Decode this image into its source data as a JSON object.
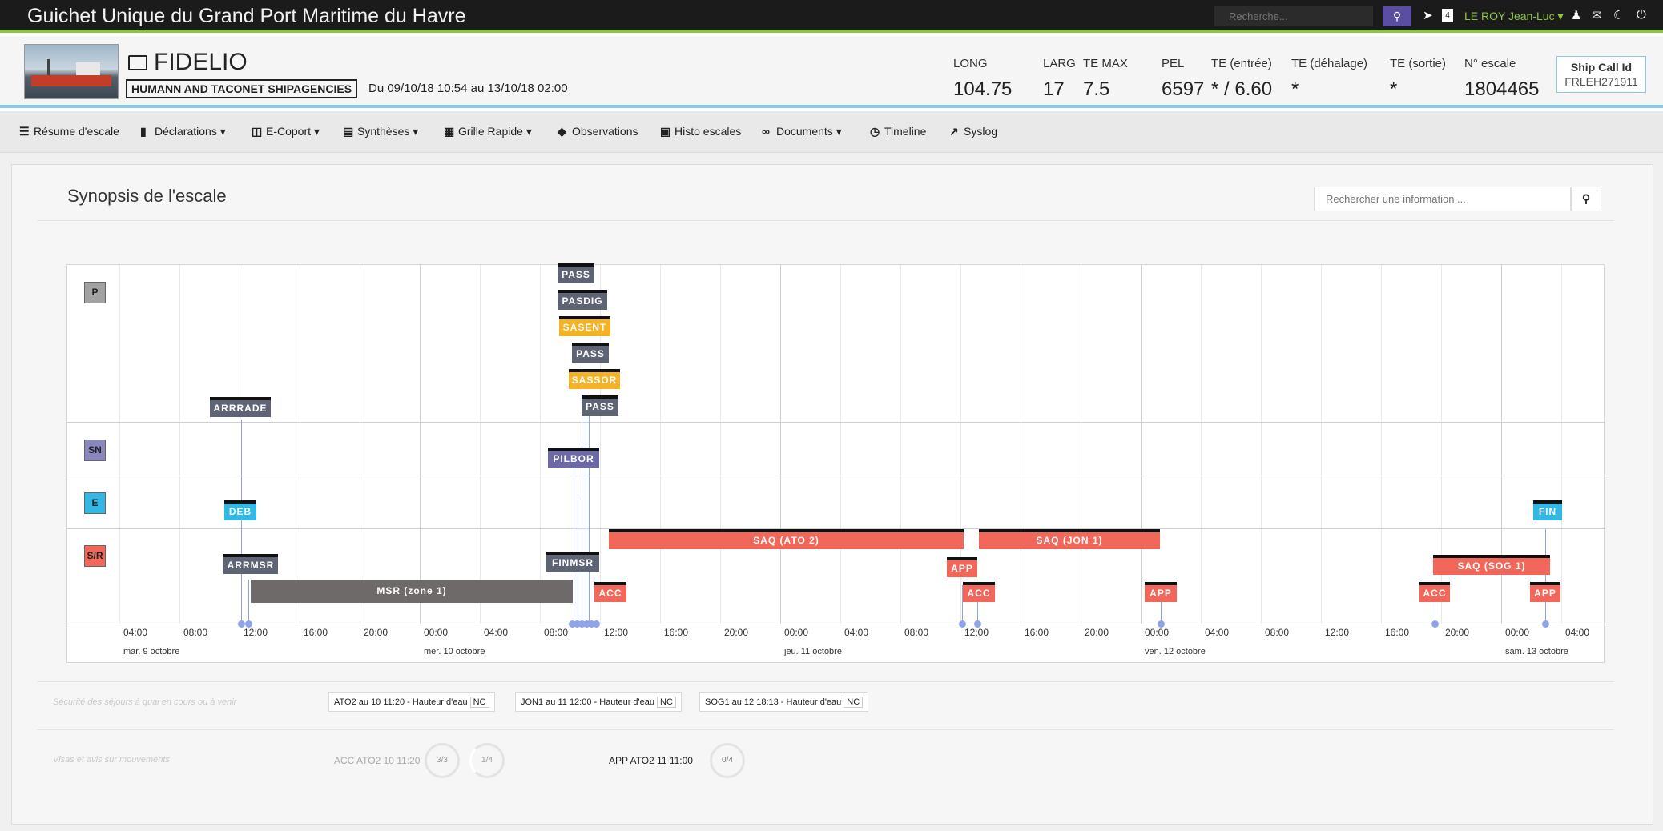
{
  "app": {
    "title": "Guichet Unique du Grand Port Maritime du Havre",
    "search_placeholder": "Recherche...",
    "notification_count": "4",
    "user": "LE ROY Jean-Luc ▾"
  },
  "ship": {
    "name": "FIDELIO",
    "agency": "HUMANN AND TACONET SHIPAGENCIES",
    "date_range": "Du 09/10/18 10:54 au 13/10/18 02:00",
    "metrics": [
      {
        "label": "LONG",
        "value": "104.75"
      },
      {
        "label": "LARG",
        "value": "17"
      },
      {
        "label": "TE MAX",
        "value": "7.5"
      },
      {
        "label": "PEL",
        "value": "6597"
      },
      {
        "label": "TE (entrée)",
        "value": "* / 6.60"
      },
      {
        "label": "TE (déhalage)",
        "value": "*"
      },
      {
        "label": "TE (sortie)",
        "value": "*"
      },
      {
        "label": "N° escale",
        "value": "1804465"
      }
    ],
    "ship_call_label": "Ship Call Id",
    "ship_call_id": "FRLEH271911"
  },
  "nav": {
    "items": [
      "Résume d'escale",
      "Déclarations ▾",
      "E-Coport ▾",
      "Synthèses ▾",
      "Grille Rapide ▾",
      "Observations",
      "Histo escales",
      "Documents ▾",
      "Timeline",
      "Syslog"
    ]
  },
  "panel": {
    "title": "Synopsis de l'escale",
    "search_placeholder": "Rechercher une information ..."
  },
  "timeline": {
    "lanes": [
      "P",
      "SN",
      "E",
      "S/R"
    ],
    "lane_colors": [
      "#a2a2a2",
      "#8a86c0",
      "#33b8e5",
      "#f3665a"
    ],
    "ticks": [
      "04:00",
      "08:00",
      "12:00",
      "16:00",
      "20:00",
      "00:00",
      "04:00",
      "08:00",
      "12:00",
      "16:00",
      "20:00",
      "00:00",
      "04:00",
      "08:00",
      "12:00",
      "16:00",
      "20:00",
      "00:00",
      "04:00",
      "08:00",
      "12:00",
      "16:00",
      "20:00",
      "00:00",
      "04:00"
    ],
    "days": [
      "mar. 9 octobre",
      "mer. 10 octobre",
      "jeu. 11 octobre",
      "ven. 12 octobre",
      "sam. 13 octobre"
    ],
    "events": [
      {
        "label": "PASS",
        "color": "dark"
      },
      {
        "label": "PASDIG",
        "color": "dark"
      },
      {
        "label": "SASENT",
        "color": "orange"
      },
      {
        "label": "PASS",
        "color": "dark"
      },
      {
        "label": "SASSOR",
        "color": "orange"
      },
      {
        "label": "PASS",
        "color": "dark"
      },
      {
        "label": "ARRRADE",
        "color": "dark"
      },
      {
        "label": "PILBOR",
        "color": "purple"
      },
      {
        "label": "DEB",
        "color": "blue"
      },
      {
        "label": "FIN",
        "color": "blue"
      },
      {
        "label": "SAQ (ATO 2)",
        "color": "red"
      },
      {
        "label": "SAQ (JON 1)",
        "color": "red"
      },
      {
        "label": "ARRMSR",
        "color": "dark"
      },
      {
        "label": "FINMSR",
        "color": "dark"
      },
      {
        "label": "APP",
        "color": "red"
      },
      {
        "label": "SAQ (SOG 1)",
        "color": "red"
      },
      {
        "label": "MSR (zone 1)",
        "color": "gray"
      },
      {
        "label": "ACC",
        "color": "red"
      },
      {
        "label": "ACC",
        "color": "red"
      },
      {
        "label": "APP",
        "color": "red"
      },
      {
        "label": "ACC",
        "color": "red"
      },
      {
        "label": "APP",
        "color": "red"
      }
    ]
  },
  "footer": {
    "safety_label": "Sécurité des séjours à quai en cours ou à venir",
    "safety_chips": [
      {
        "text": "ATO2 au 10 11:20 - Hauteur d'eau",
        "flag": "NC"
      },
      {
        "text": "JON1 au 11 12:00 - Hauteur d'eau",
        "flag": "NC"
      },
      {
        "text": "SOG1 au 12 18:13 - Hauteur d'eau",
        "flag": "NC"
      }
    ],
    "visas_label": "Visas et avis sur mouvements",
    "movements": [
      {
        "text": "ACC ATO2 10 11:20",
        "ring1": "3/3",
        "ring2": "1/4"
      },
      {
        "text": "APP ATO2 11 11:00",
        "ring1": "0/4"
      }
    ]
  }
}
